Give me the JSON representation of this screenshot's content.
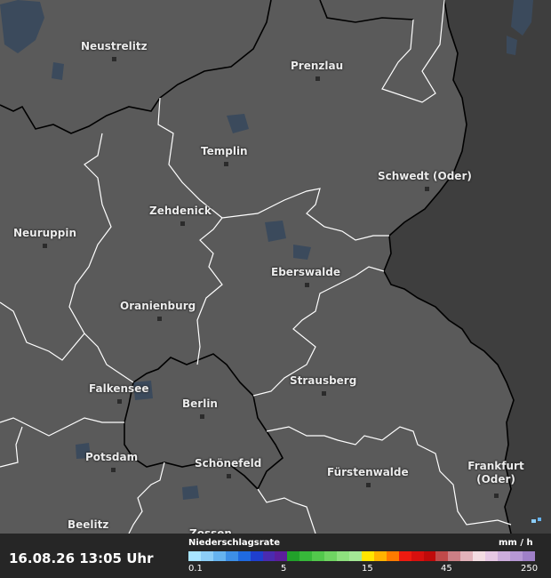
{
  "map": {
    "colors": {
      "land": "#5a5a5a",
      "outside": "#3e3e3e",
      "water": "#3b4a5c",
      "border": "#ffffff",
      "state_border": "#000000"
    },
    "cities": [
      {
        "name": "Neustrelitz"
      },
      {
        "name": "Prenzlau"
      },
      {
        "name": "Templin"
      },
      {
        "name": "Schwedt (Oder)"
      },
      {
        "name": "Zehdenick"
      },
      {
        "name": "Neuruppin"
      },
      {
        "name": "Eberswalde"
      },
      {
        "name": "Oranienburg"
      },
      {
        "name": "Strausberg"
      },
      {
        "name": "Falkensee"
      },
      {
        "name": "Berlin"
      },
      {
        "name": "Potsdam"
      },
      {
        "name": "Schönefeld"
      },
      {
        "name": "Fürstenwalde"
      },
      {
        "name": "Frankfurt (Oder)"
      },
      {
        "name": "Beelitz"
      },
      {
        "name": "Zossen"
      }
    ]
  },
  "footer": {
    "timestamp": "16.08.26 13:05 Uhr",
    "legend": {
      "title": "Niederschlagsrate",
      "unit": "mm / h",
      "ticks": [
        "0.1",
        "5",
        "15",
        "45",
        "250"
      ],
      "colors": [
        "#a8e4ff",
        "#8ccdf7",
        "#66b3ef",
        "#3d8fe6",
        "#1f6ae0",
        "#1f3fcf",
        "#4a2bb0",
        "#5c1e9c",
        "#21a12a",
        "#37b83a",
        "#52c84c",
        "#6fd462",
        "#8ee07e",
        "#a4e896",
        "#ffe600",
        "#ffb300",
        "#ff7a00",
        "#ee1b10",
        "#d8100e",
        "#c00a0a",
        "#c04a4a",
        "#cc7f85",
        "#e2b2ba",
        "#f3dce2",
        "#e6c8e4",
        "#cdaedc",
        "#b698d4",
        "#9f80c8"
      ]
    }
  }
}
